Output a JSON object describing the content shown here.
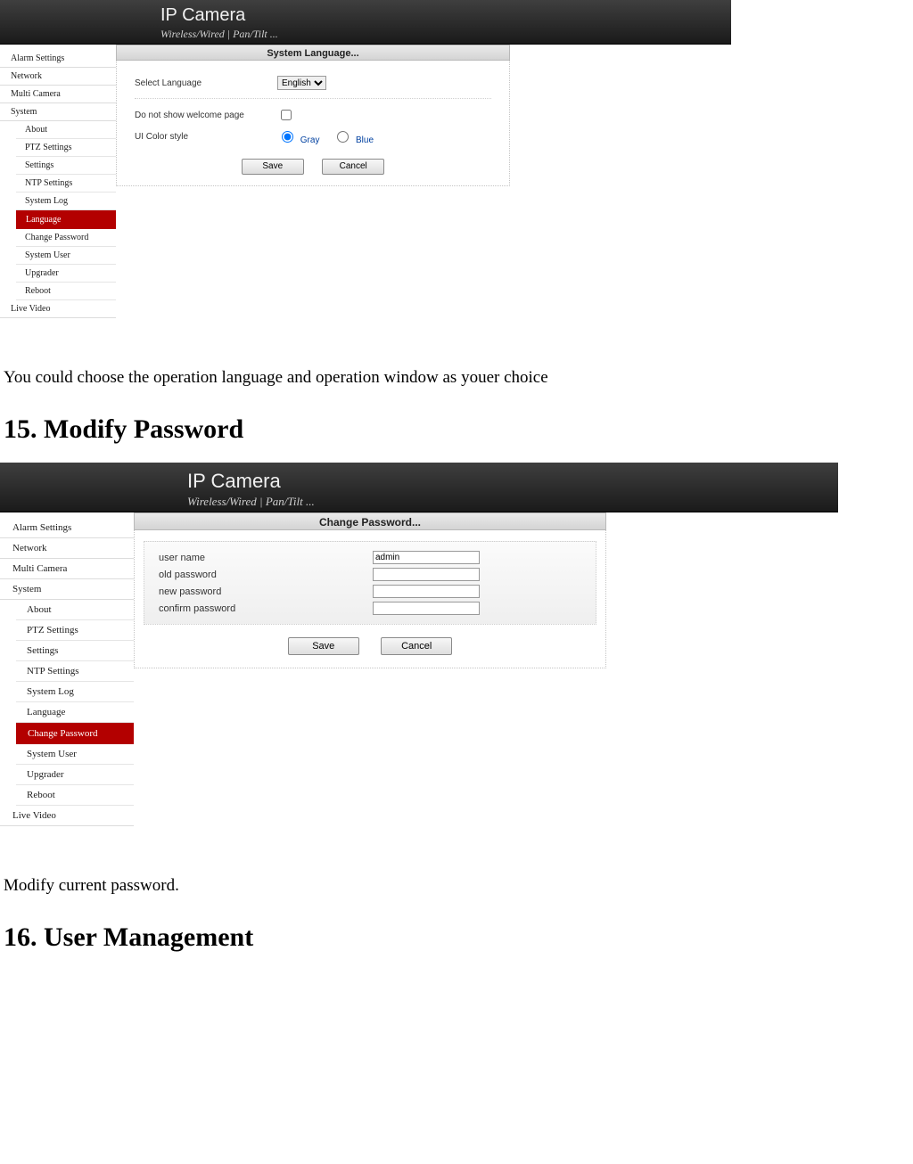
{
  "branding": {
    "title": "IP Camera",
    "subtitle": "Wireless/Wired  |  Pan/Tilt  ..."
  },
  "nav": {
    "top": [
      "Alarm Settings",
      "Network",
      "Multi Camera",
      "System"
    ],
    "system_sub": [
      "About",
      "PTZ Settings",
      "Settings",
      "NTP Settings",
      "System Log",
      "Language",
      "Change Password",
      "System User",
      "Upgrader",
      "Reboot"
    ],
    "after": [
      "Live Video"
    ]
  },
  "shot1": {
    "panel_title": "System Language...",
    "rows": {
      "select_language_label": "Select Language",
      "select_language_value": "English",
      "welcome_label": "Do not show welcome page",
      "ui_style_label": "UI Color style",
      "ui_style_gray": "Gray",
      "ui_style_blue": "Blue"
    },
    "buttons": {
      "save": "Save",
      "cancel": "Cancel"
    },
    "active_sub": "Language"
  },
  "caption1": "You could choose the operation language and operation window as youer choice",
  "heading15": "15. Modify Password",
  "shot2": {
    "panel_title": "Change Password...",
    "rows": {
      "username_label": "user name",
      "username_value": "admin",
      "oldpw_label": "old password",
      "newpw_label": "new password",
      "confirmpw_label": "confirm password"
    },
    "buttons": {
      "save": "Save",
      "cancel": "Cancel"
    },
    "active_sub": "Change Password"
  },
  "caption2": "Modify current password.",
  "heading16": "16. User Management"
}
